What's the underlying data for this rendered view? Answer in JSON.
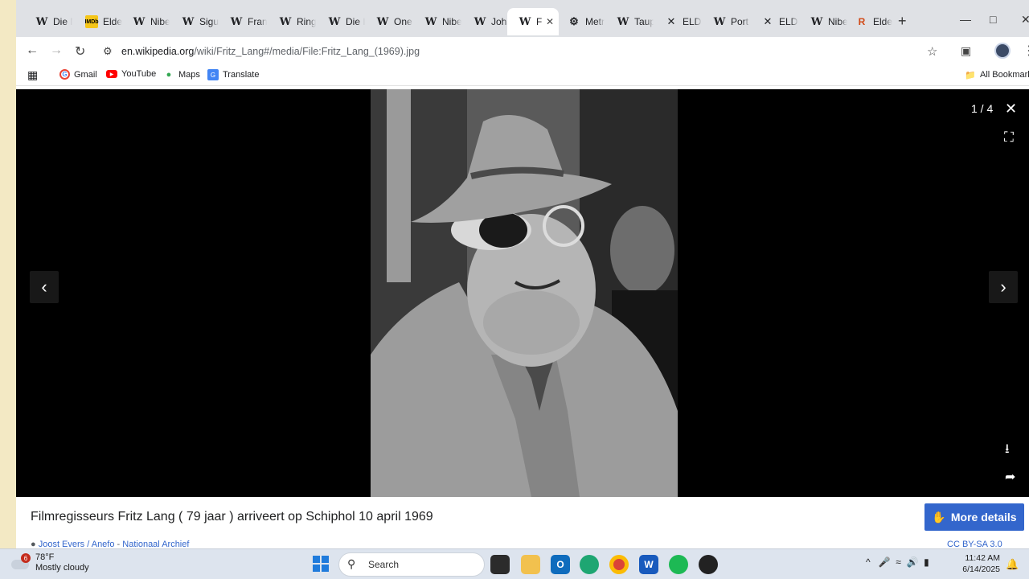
{
  "tabs": [
    {
      "label": "Die N",
      "icon": "wikipedia-icon"
    },
    {
      "label": "Elder",
      "icon": "imdb-icon"
    },
    {
      "label": "Nibe",
      "icon": "wikipedia-icon"
    },
    {
      "label": "Sigur",
      "icon": "wikipedia-icon"
    },
    {
      "label": "Fran",
      "icon": "wikipedia-icon"
    },
    {
      "label": "Ring",
      "icon": "wikipedia-icon"
    },
    {
      "label": "Die I",
      "icon": "wikipedia-icon"
    },
    {
      "label": "One",
      "icon": "wikipedia-icon"
    },
    {
      "label": "Nibe",
      "icon": "wikipedia-icon"
    },
    {
      "label": "Joha",
      "icon": "wikipedia-icon"
    },
    {
      "label": "F",
      "icon": "wikipedia-icon",
      "active": true
    },
    {
      "label": "Metr",
      "icon": "metropolis-icon"
    },
    {
      "label": "Taup",
      "icon": "wikipedia-icon"
    },
    {
      "label": "ELDE",
      "icon": "x-icon"
    },
    {
      "label": "Port",
      "icon": "wikipedia-icon"
    },
    {
      "label": "ELDE",
      "icon": "x-icon"
    },
    {
      "label": "Nibe",
      "icon": "wikipedia-icon"
    },
    {
      "label": "Elde",
      "icon": "reddit-r-icon"
    }
  ],
  "address": {
    "domain": "en.wikipedia.org",
    "path": "/wiki/Fritz_Lang#/media/File:Fritz_Lang_(1969).jpg"
  },
  "bookmarks": {
    "items": [
      "Gmail",
      "YouTube",
      "Maps",
      "Translate"
    ],
    "all_label": "All Bookmarks"
  },
  "viewer": {
    "counter": "1 / 4",
    "caption": "Filmregisseurs Fritz Lang ( 79 jaar ) arriveert op Schiphol 10 april 1969",
    "more_details": "More details",
    "credit_author": "Joost Evers / Anefo",
    "credit_sep": " - ",
    "credit_source": "Nationaal Archief",
    "license": "CC BY-SA 3.0"
  },
  "taskbar": {
    "weather_temp": "78°F",
    "weather_desc": "Mostly cloudy",
    "weather_badge": "6",
    "search_placeholder": "Search",
    "time": "11:42 AM",
    "date": "6/14/2025"
  },
  "colors": {
    "accent_button": "#3366cc",
    "viewer_bg": "#000000",
    "tabbar_bg": "#dfe1e5"
  }
}
